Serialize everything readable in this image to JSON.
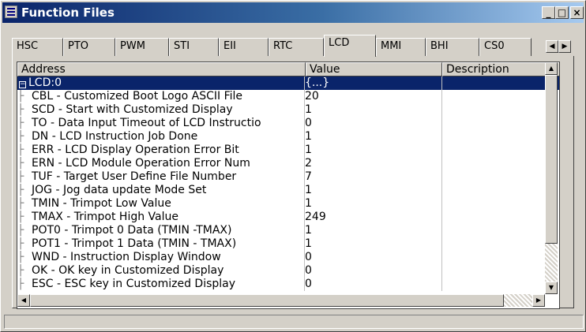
{
  "window": {
    "title": "Function Files",
    "minimize": "_",
    "maximize": "□",
    "close": "×"
  },
  "tabs": [
    {
      "label": "HSC"
    },
    {
      "label": "PTO"
    },
    {
      "label": "PWM"
    },
    {
      "label": "STI"
    },
    {
      "label": "EII"
    },
    {
      "label": "RTC"
    },
    {
      "label": "LCD"
    },
    {
      "label": "MMI"
    },
    {
      "label": "BHI"
    },
    {
      "label": "CS0"
    }
  ],
  "active_tab": "LCD",
  "tab_scroll": {
    "left": "◀",
    "right": "▶"
  },
  "grid": {
    "columns": [
      "Address",
      "Value",
      "Description"
    ],
    "rows": [
      {
        "address": "LCD:0",
        "value": "{...}",
        "description": "",
        "selected": true,
        "root": true,
        "expander": "−"
      },
      {
        "address": "CBL - Customized Boot Logo ASCII File",
        "value": "20",
        "description": ""
      },
      {
        "address": "SCD - Start with Customized Display",
        "value": "1",
        "description": ""
      },
      {
        "address": "TO - Data Input Timeout of LCD Instructio",
        "value": "0",
        "description": ""
      },
      {
        "address": "DN - LCD Instruction Job Done",
        "value": "1",
        "description": ""
      },
      {
        "address": "ERR - LCD Display Operation Error Bit",
        "value": "1",
        "description": ""
      },
      {
        "address": "ERN - LCD Module Operation Error Num",
        "value": "2",
        "description": ""
      },
      {
        "address": "TUF - Target User Define File Number",
        "value": "7",
        "description": ""
      },
      {
        "address": "JOG - Jog data update Mode Set",
        "value": "1",
        "description": ""
      },
      {
        "address": "TMIN - Trimpot Low Value",
        "value": "1",
        "description": ""
      },
      {
        "address": "TMAX - Trimpot High Value",
        "value": "249",
        "description": ""
      },
      {
        "address": "POT0 - Trimpot 0 Data (TMIN -TMAX)",
        "value": "1",
        "description": ""
      },
      {
        "address": "POT1 - Trimpot 1 Data (TMIN - TMAX)",
        "value": "1",
        "description": ""
      },
      {
        "address": "WND - Instruction Display Window",
        "value": "0",
        "description": ""
      },
      {
        "address": "OK - OK key in Customized Display",
        "value": "0",
        "description": ""
      },
      {
        "address": "ESC - ESC key in Customized Display",
        "value": "0",
        "description": ""
      }
    ]
  },
  "scrollbars": {
    "up": "▲",
    "down": "▼",
    "left": "◀",
    "right": "▶"
  }
}
